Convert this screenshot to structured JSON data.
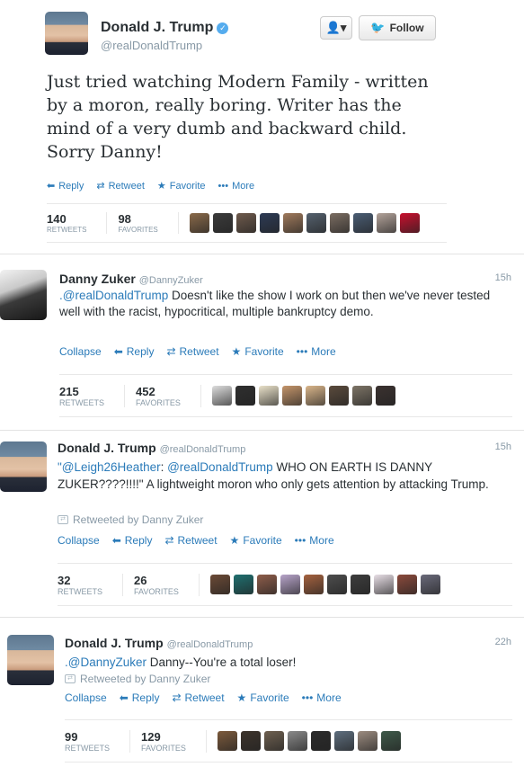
{
  "colors": {
    "link": "#2b7bb9",
    "muted": "#8899a6",
    "verified": "#55acee",
    "text": "#292f33"
  },
  "tweet1": {
    "name": "Donald J. Trump",
    "handle": "@realDonaldTrump",
    "follow_label": "Follow",
    "user_menu_icon": "person-dropdown-icon",
    "text": "Just tried watching Modern Family - written by a moron, really boring. Writer has the mind of a very dumb and backward child. Sorry Danny!",
    "actions": {
      "reply": "Reply",
      "retweet": "Retweet",
      "favorite": "Favorite",
      "more": "More"
    },
    "stats": {
      "retweets": "140",
      "retweets_label": "RETWEETS",
      "favorites": "98",
      "favorites_label": "FAVORITES"
    }
  },
  "tweet2": {
    "name": "Danny Zuker",
    "handle": "@DannyZuker",
    "time": "15h",
    "mention": ".@realDonaldTrump",
    "text": "Doesn't like the show I work on but then we've never tested well with the racist, hypocritical, multiple bankruptcy demo.",
    "actions": {
      "collapse": "Collapse",
      "reply": "Reply",
      "retweet": "Retweet",
      "favorite": "Favorite",
      "more": "More"
    },
    "stats": {
      "retweets": "215",
      "retweets_label": "RETWEETS",
      "favorites": "452",
      "favorites_label": "FAVORITES"
    }
  },
  "tweet3": {
    "name": "Donald J. Trump",
    "handle": "@realDonaldTrump",
    "time": "15h",
    "quote_open": "\"",
    "mention1": "@Leigh26Heather",
    "colon": ": ",
    "mention2": "@realDonaldTrump",
    "text": "WHO ON EARTH IS DANNY ZUKER????!!!!\" A lightweight moron who only gets attention by attacking Trump.",
    "retweeted_by": "Retweeted by Danny Zuker",
    "actions": {
      "collapse": "Collapse",
      "reply": "Reply",
      "retweet": "Retweet",
      "favorite": "Favorite",
      "more": "More"
    },
    "stats": {
      "retweets": "32",
      "retweets_label": "RETWEETS",
      "favorites": "26",
      "favorites_label": "FAVORITES"
    }
  },
  "tweet4": {
    "name": "Donald J. Trump",
    "handle": "@realDonaldTrump",
    "time": "22h",
    "mention": ".@DannyZuker",
    "text": "Danny--You're a total loser!",
    "retweeted_by": "Retweeted by Danny Zuker",
    "actions": {
      "collapse": "Collapse",
      "reply": "Reply",
      "retweet": "Retweet",
      "favorite": "Favorite",
      "more": "More"
    },
    "stats": {
      "retweets": "99",
      "retweets_label": "RETWEETS",
      "favorites": "129",
      "favorites_label": "FAVORITES"
    }
  },
  "faces": {
    "t1": [
      "#8a6a4a",
      "#3b3b3b",
      "#6e5a4c",
      "#2d3b55",
      "#a07a5c",
      "#55616e",
      "#7b6d62",
      "#4a5d74",
      "#b3a39a",
      "#c8102e"
    ],
    "t2": [
      "#dddddd",
      "#2f2f2f",
      "#e9e1c9",
      "#c4956a",
      "#d9b58a",
      "#5a4a3c",
      "#7d7466",
      "#3b3230"
    ],
    "t3": [
      "#6b4a36",
      "#1f6f6f",
      "#8e5d4a",
      "#b7a4c9",
      "#a5623f",
      "#4d4d4d",
      "#3d3d3d",
      "#e8dfe6",
      "#8b4a3c",
      "#6a6a7a"
    ],
    "t4": [
      "#7c5a3c",
      "#3d342c",
      "#6e6050",
      "#8a8a8a",
      "#2b2b2b",
      "#5e6e7e",
      "#9c8c80",
      "#3f5a4a"
    ]
  }
}
